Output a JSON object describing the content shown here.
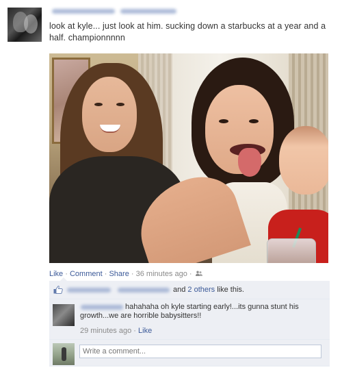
{
  "post": {
    "text": "look at kyle... just look at him. sucking down a starbucks at a year and a half. championnnnn"
  },
  "actions": {
    "like": "Like",
    "comment": "Comment",
    "share": "Share",
    "separator": "·",
    "timestamp": "36 minutes ago",
    "audience_icon": "friends-icon"
  },
  "likes": {
    "text_middle": "and",
    "others_link": "2 others",
    "text_end": "like this."
  },
  "comment": {
    "text": "hahahaha oh kyle starting early!...its gunna stunt his growth...we are horrible babysitters!!",
    "timestamp": "29 minutes ago",
    "like_label": "Like"
  },
  "composer": {
    "placeholder": "Write a comment..."
  },
  "colors": {
    "link": "#3b5998",
    "ufi_background": "#edeff4",
    "muted_text": "#8a8a8a"
  }
}
